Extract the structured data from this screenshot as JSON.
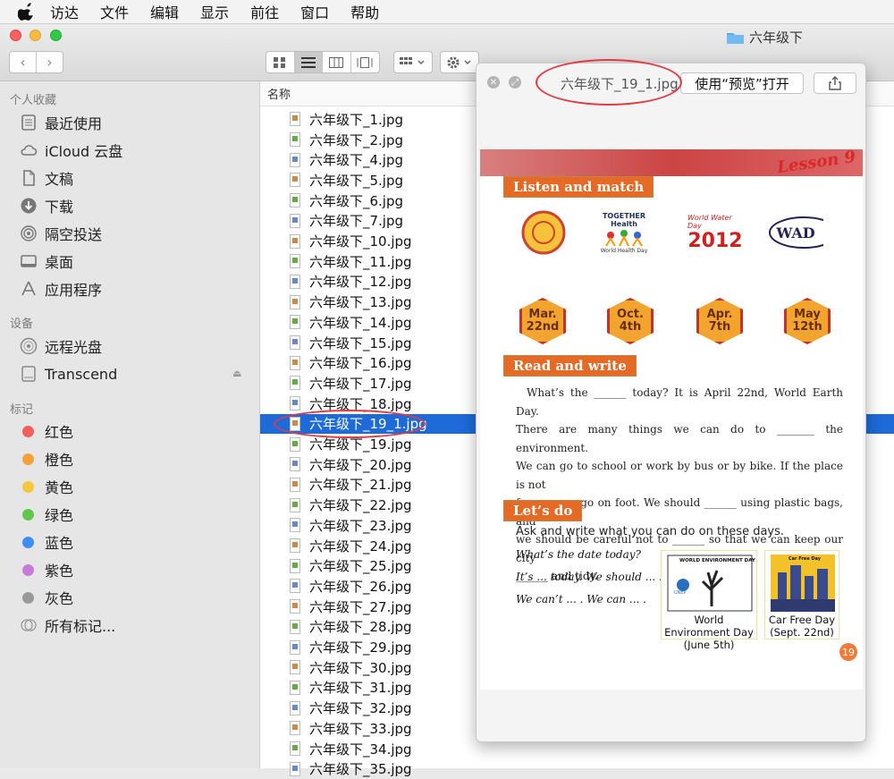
{
  "menubar": {
    "items": [
      "访达",
      "文件",
      "编辑",
      "显示",
      "前往",
      "窗口",
      "帮助"
    ]
  },
  "window": {
    "title": "六年级下"
  },
  "sidebar": {
    "favorites_header": "个人收藏",
    "favorites": [
      "最近使用",
      "iCloud 云盘",
      "文稿",
      "下载",
      "隔空投送",
      "桌面",
      "应用程序"
    ],
    "devices_header": "设备",
    "devices": [
      "远程光盘",
      "Transcend"
    ],
    "tags_header": "标记",
    "tags": [
      {
        "label": "红色",
        "color": "#f25f5c"
      },
      {
        "label": "橙色",
        "color": "#f6a037"
      },
      {
        "label": "黄色",
        "color": "#f5c73b"
      },
      {
        "label": "绿色",
        "color": "#5ec84b"
      },
      {
        "label": "蓝色",
        "color": "#3f8ef5"
      },
      {
        "label": "紫色",
        "color": "#c77bd9"
      },
      {
        "label": "灰色",
        "color": "#9a9a9a"
      }
    ],
    "all_tags": "所有标记..."
  },
  "list": {
    "column_name": "名称",
    "files": [
      "六年级下_1.jpg",
      "六年级下_2.jpg",
      "六年级下_4.jpg",
      "六年级下_5.jpg",
      "六年级下_6.jpg",
      "六年级下_7.jpg",
      "六年级下_10.jpg",
      "六年级下_11.jpg",
      "六年级下_12.jpg",
      "六年级下_13.jpg",
      "六年级下_14.jpg",
      "六年级下_15.jpg",
      "六年级下_16.jpg",
      "六年级下_17.jpg",
      "六年级下_18.jpg",
      "六年级下_19_1.jpg",
      "六年级下_19.jpg",
      "六年级下_20.jpg",
      "六年级下_21.jpg",
      "六年级下_22.jpg",
      "六年级下_23.jpg",
      "六年级下_24.jpg",
      "六年级下_25.jpg",
      "六年级下_26.jpg",
      "六年级下_27.jpg",
      "六年级下_28.jpg",
      "六年级下_29.jpg",
      "六年级下_30.jpg",
      "六年级下_31.jpg",
      "六年级下_32.jpg",
      "六年级下_33.jpg",
      "六年级下_34.jpg",
      "六年级下_35.jpg"
    ],
    "selected": "六年级下_19_1.jpg"
  },
  "quicklook": {
    "title": "六年级下_19_1.jpg",
    "open_button": "使用“预览”打开"
  },
  "page": {
    "lesson": "Lesson 9",
    "section1": "Listen and match",
    "logo_text": [
      "TOGETHER",
      "Health",
      "World Health Day",
      "World Water Day",
      "2012",
      "WAD"
    ],
    "dates": [
      "Mar. 22nd",
      "Oct. 4th",
      "Apr. 7th",
      "May 12th"
    ],
    "section2": "Read and write",
    "paragraph": [
      "What’s the ______ today? It is April 22nd, World Earth Day.",
      "There are many things we can do to _______ the environment.",
      "We can go to school or work by bus or by bike. If the place is not",
      "far, we can go on foot. We should ______ using plastic bags, and",
      "we should be careful not to ______ so that we can keep our city",
      "______ and tidy."
    ],
    "section3": "Let’s do",
    "ask": "Ask and write what you can do on these days.",
    "questions": [
      "What’s the date today?",
      "It’s ... today. We should ... .",
      "We can’t ... . We can ... ."
    ],
    "card1_header": "WORLD ENVIRONMENT DAY",
    "card1_logo": "UNEP",
    "card1_caption": "World Environment Day (June 5th)",
    "card2_header": "Car Free Day",
    "card2_caption": "Car Free Day (Sept. 22nd)",
    "page_number": "19"
  }
}
